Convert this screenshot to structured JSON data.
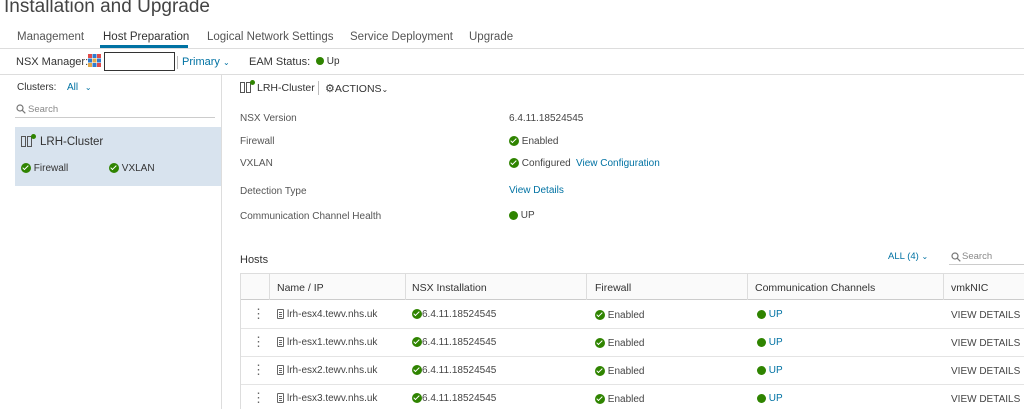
{
  "page": {
    "title": "Installation and Upgrade"
  },
  "tabs": [
    {
      "label": "Management"
    },
    {
      "label": "Host Preparation"
    },
    {
      "label": "Logical Network Settings"
    },
    {
      "label": "Service Deployment"
    },
    {
      "label": "Upgrade"
    }
  ],
  "toolbar": {
    "nsx_manager_label": "NSX Manager:",
    "nsx_manager_value": "",
    "role": "Primary",
    "eam_label": "EAM Status:",
    "eam_value": "Up"
  },
  "sidebar": {
    "clusters_label": "Clusters:",
    "filter": "All",
    "search_placeholder": "Search",
    "cluster": {
      "name": "LRH-Cluster",
      "firewall": "Firewall",
      "vxlan": "VXLAN"
    }
  },
  "detail": {
    "cluster_name": "LRH-Cluster",
    "actions_label": "ACTIONS",
    "properties": {
      "nsx_version_label": "NSX Version",
      "nsx_version_value": "6.4.11.18524545",
      "firewall_label": "Firewall",
      "firewall_value": "Enabled",
      "vxlan_label": "VXLAN",
      "vxlan_value": "Configured",
      "vxlan_link": "View Configuration",
      "detection_label": "Detection Type",
      "detection_link": "View Details",
      "comm_label": "Communication Channel Health",
      "comm_value": "UP"
    }
  },
  "hosts": {
    "title": "Hosts",
    "filter": "ALL (4)",
    "search_placeholder": "Search",
    "columns": {
      "name": "Name / IP",
      "nsx": "NSX Installation",
      "firewall": "Firewall",
      "comm": "Communication Channels",
      "vmknic": "vmkNIC"
    },
    "rows": [
      {
        "name": "lrh-esx4.tewv.nhs.uk",
        "nsx": "6.4.11.18524545",
        "firewall": "Enabled",
        "comm": "UP",
        "vmknic": "VIEW DETAILS"
      },
      {
        "name": "lrh-esx1.tewv.nhs.uk",
        "nsx": "6.4.11.18524545",
        "firewall": "Enabled",
        "comm": "UP",
        "vmknic": "VIEW DETAILS"
      },
      {
        "name": "lrh-esx2.tewv.nhs.uk",
        "nsx": "6.4.11.18524545",
        "firewall": "Enabled",
        "comm": "UP",
        "vmknic": "VIEW DETAILS"
      },
      {
        "name": "lrh-esx3.tewv.nhs.uk",
        "nsx": "6.4.11.18524545",
        "firewall": "Enabled",
        "comm": "UP",
        "vmknic": "VIEW DETAILS"
      }
    ]
  }
}
